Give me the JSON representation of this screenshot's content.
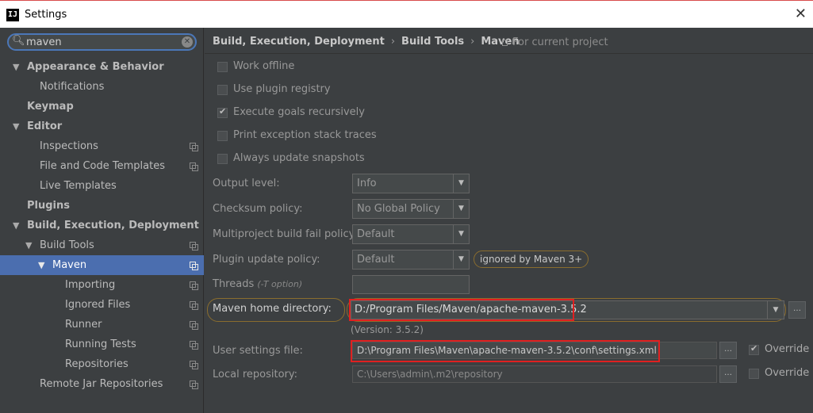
{
  "window": {
    "title": "Settings",
    "app_icon_text": "IJ"
  },
  "search": {
    "value": "maven"
  },
  "sidebar": {
    "items": [
      {
        "label": "Appearance & Behavior"
      },
      {
        "label": "Notifications"
      },
      {
        "label": "Keymap"
      },
      {
        "label": "Editor"
      },
      {
        "label": "Inspections"
      },
      {
        "label": "File and Code Templates"
      },
      {
        "label": "Live Templates"
      },
      {
        "label": "Plugins"
      },
      {
        "label": "Build, Execution, Deployment"
      },
      {
        "label": "Build Tools"
      },
      {
        "label": "Maven"
      },
      {
        "label": "Importing"
      },
      {
        "label": "Ignored Files"
      },
      {
        "label": "Runner"
      },
      {
        "label": "Running Tests"
      },
      {
        "label": "Repositories"
      },
      {
        "label": "Remote Jar Repositories"
      }
    ]
  },
  "breadcrumb": {
    "part1": "Build, Execution, Deployment",
    "part2": "Build Tools",
    "part3": "Maven",
    "scope": "For current project"
  },
  "checkboxes": {
    "work_offline": "Work offline",
    "use_plugin_registry": "Use plugin registry",
    "execute_goals_recursively": "Execute goals recursively",
    "print_exception_stack_traces": "Print exception stack traces",
    "always_update_snapshots": "Always update snapshots"
  },
  "form": {
    "output_level": {
      "label": "Output level:",
      "value": "Info"
    },
    "checksum_policy": {
      "label": "Checksum policy:",
      "value": "No Global Policy"
    },
    "multiproject_fail_policy": {
      "label": "Multiproject build fail policy:",
      "value": "Default"
    },
    "plugin_update_policy": {
      "label": "Plugin update policy:",
      "value": "Default",
      "note": "ignored by Maven 3+"
    },
    "threads": {
      "label": "Threads",
      "hint": "(-T option)"
    },
    "maven_home": {
      "label": "Maven home directory:",
      "value": "D:/Program Files/Maven/apache-maven-3.5.2",
      "version": "(Version: 3.5.2)"
    },
    "user_settings": {
      "label": "User settings file:",
      "value": "D:\\Program Files\\Maven\\apache-maven-3.5.2\\conf\\settings.xml",
      "override": "Override"
    },
    "local_repo": {
      "label": "Local repository:",
      "value": "C:\\Users\\admin\\.m2\\repository",
      "override": "Override"
    }
  },
  "icons": {
    "search": "search-icon",
    "clear": "clear-icon",
    "close": "close-icon",
    "copy": "copy-settings-icon",
    "browse": "browse-icon"
  },
  "colors": {
    "accent": "#4b6eaf",
    "highlight_red": "#e02020",
    "highlight_gold": "#8a6d2e",
    "background": "#3c3f41"
  }
}
